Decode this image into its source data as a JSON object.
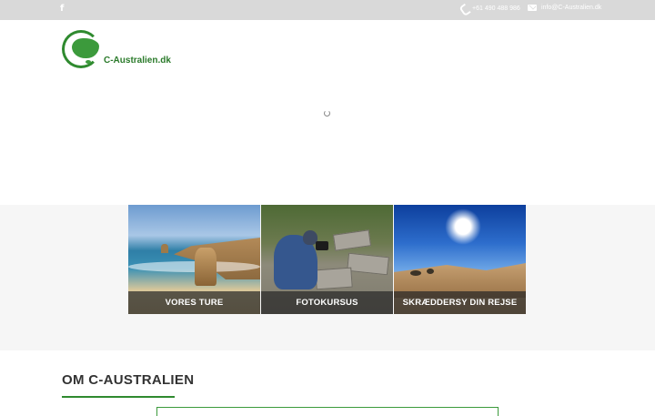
{
  "topbar": {
    "social_icon": "facebook-icon",
    "social_glyph": "f",
    "phone_icon": "phone-icon",
    "phone": "+61 490 488 986",
    "email_icon": "envelope-icon",
    "email": "info@C-Australien.dk"
  },
  "logo": {
    "text": "C-Australien.dk",
    "icon": "australia-map-icon"
  },
  "loader": {
    "icon": "loading-spinner-icon"
  },
  "tiles": [
    {
      "label": "VORES TURE",
      "image": "twelve-apostles-coast"
    },
    {
      "label": "FOTOKURSUS",
      "image": "photographer-on-rocks"
    },
    {
      "label": "SKRÆDDERSY DIN REJSE",
      "image": "desert-sun"
    }
  ],
  "about": {
    "title": "OM C-AUSTRALIEN"
  },
  "colors": {
    "accent": "#2f8a2f",
    "topbar": "#d9d9d9",
    "band": "#f6f6f6",
    "caption_bg": "#282828"
  }
}
